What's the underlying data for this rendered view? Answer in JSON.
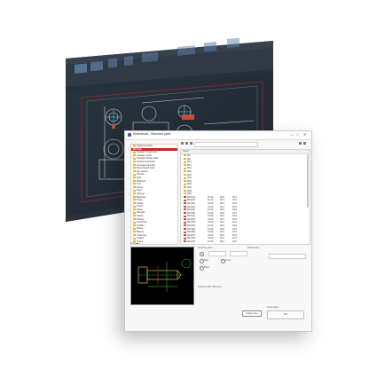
{
  "cad_window": {
    "tabs": [
      "Drawing1",
      "Sample Parts"
    ],
    "toolbar_groups": [
      "Home",
      "Insert",
      "Annotate",
      "Parametric",
      "View",
      "Manage",
      "Output",
      "Express Tools",
      "Mechanical"
    ]
  },
  "dialog": {
    "title": "Mechanical - Standard parts",
    "controls": {
      "minimize": "—",
      "maximize": "□",
      "close": "✕"
    },
    "tree_items": [
      "Fastening parts",
      "Bolts",
      "Hexagon head bolts",
      "Hexagon bolts",
      "Hexagon flange bolts",
      "Socket head bolts",
      "Countersunk bolts",
      "Round head bolts",
      "Set screws",
      "Screws",
      "Nuts",
      "Washers",
      "Pins",
      "Rivets",
      "Keys",
      "Springs",
      "Bearings",
      "Seals",
      "Shafts",
      "Gears",
      "Pipes",
      "Flanges",
      "Valves",
      "Fittings",
      "Structural",
      "Profiles",
      "Plates",
      "Beams",
      "Channels",
      "Angles",
      "Tubes",
      "Misc"
    ],
    "selected_tree_index": 1,
    "list_header": "Name",
    "list_rows": [
      {
        "name": "M6"
      },
      {
        "name": "M8"
      },
      {
        "name": "M10"
      },
      {
        "name": "M12"
      },
      {
        "name": "M14"
      },
      {
        "name": "M16"
      },
      {
        "name": "M20"
      },
      {
        "name": "M24"
      },
      {
        "name": "M30"
      },
      {
        "name": "M36"
      },
      {
        "name": "M42"
      },
      {
        "name": "M48"
      },
      {
        "name": "M56"
      },
      {
        "name": "M10x12",
        "c1": "10.00",
        "c2": "20.0",
        "c3": "15.0"
      },
      {
        "name": "M10x16",
        "c1": "10.00",
        "c2": "20.0",
        "c3": "15.0"
      },
      {
        "name": "M10x20",
        "c1": "10.00",
        "c2": "20.0",
        "c3": "15.0"
      },
      {
        "name": "M10x25",
        "c1": "10.00",
        "c2": "20.0",
        "c3": "15.0"
      },
      {
        "name": "M10x30",
        "c1": "10.00",
        "c2": "20.0",
        "c3": "15.0"
      },
      {
        "name": "M10x35",
        "c1": "10.00",
        "c2": "20.0",
        "c3": "15.0"
      },
      {
        "name": "M10x40",
        "c1": "10.00",
        "c2": "20.0",
        "c3": "15.0"
      },
      {
        "name": "M10x45",
        "c1": "10.00",
        "c2": "20.0",
        "c3": "15.0"
      },
      {
        "name": "M10x50",
        "c1": "10.00",
        "c2": "20.0",
        "c3": "15.0"
      },
      {
        "name": "M10x55",
        "c1": "10.00",
        "c2": "20.0",
        "c3": "15.0"
      },
      {
        "name": "M10x60",
        "c1": "10.00",
        "c2": "20.0",
        "c3": "15.0"
      },
      {
        "name": "M10x65",
        "c1": "10.00",
        "c2": "20.0",
        "c3": "15.0"
      },
      {
        "name": "M10x70",
        "c1": "10.00",
        "c2": "20.0",
        "c3": "15.0"
      },
      {
        "name": "M10x80",
        "c1": "10.00",
        "c2": "20.0",
        "c3": "15.0"
      },
      {
        "name": "M10x90",
        "c1": "10.00",
        "c2": "20.0",
        "c3": "15.0"
      }
    ],
    "preview_label": "Preview",
    "params": {
      "label": "Insertion point",
      "options": [
        "Top",
        "Side",
        "Front",
        "Back"
      ],
      "right_label": "Parameters",
      "field_placeholder": "Value",
      "insert_label": "Insert parts",
      "check_label": "Connect with reference"
    },
    "buttons": {
      "ok": "OK",
      "more": "Insert more"
    }
  }
}
